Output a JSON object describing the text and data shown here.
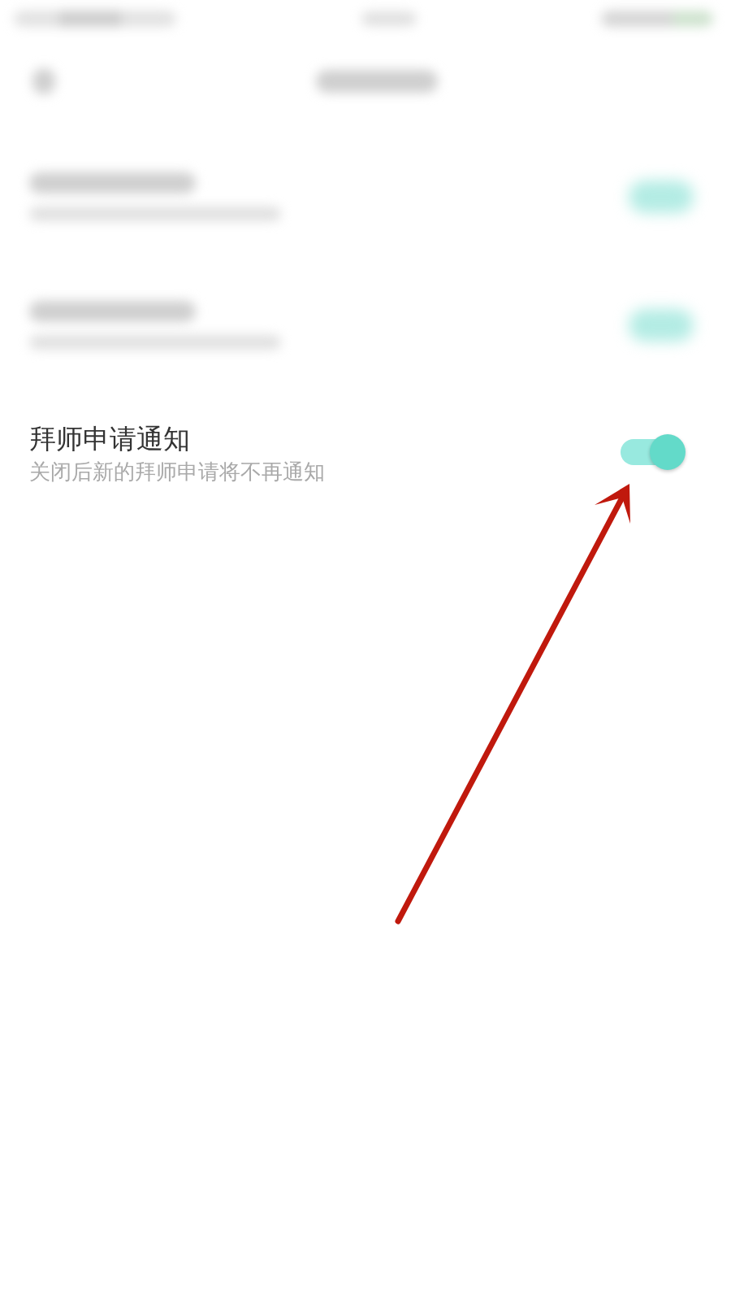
{
  "status_bar": {
    "kind": "blurred"
  },
  "header": {
    "kind": "blurred"
  },
  "settings": [
    {
      "kind": "blurred",
      "on": true
    },
    {
      "kind": "blurred",
      "on": true
    },
    {
      "kind": "text",
      "title": "拜师申请通知",
      "subtitle": "关闭后新的拜师申请将不再通知",
      "on": true
    }
  ],
  "annotations": [
    {
      "kind": "arrow"
    }
  ]
}
